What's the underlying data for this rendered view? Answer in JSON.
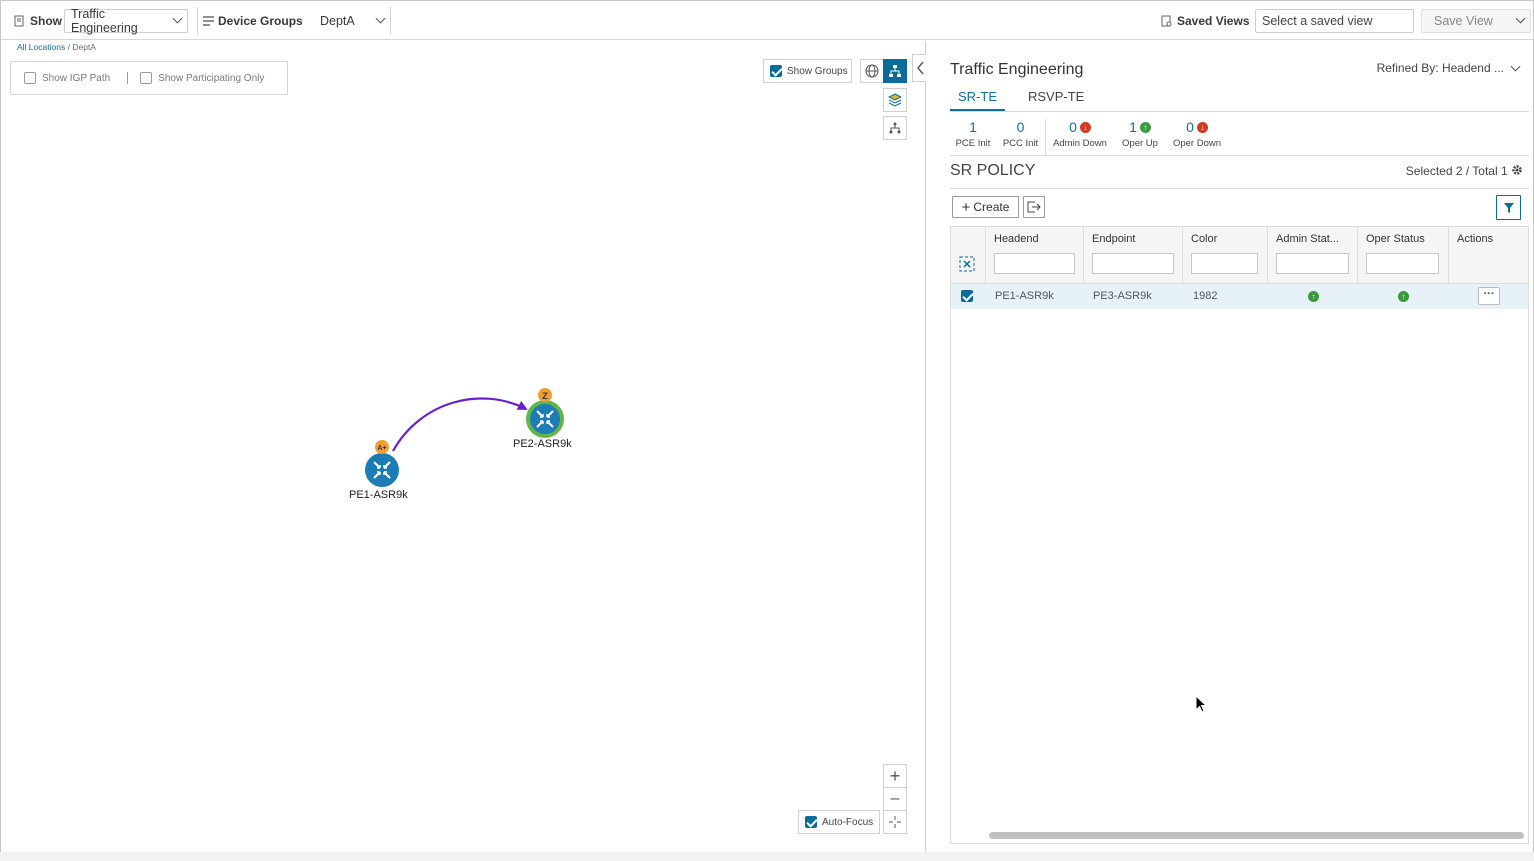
{
  "topbar": {
    "show_label": "Show",
    "show_value": "Traffic Engineering",
    "device_groups_label": "Device Groups",
    "device_group_value": "DeptA",
    "saved_views_label": "Saved Views",
    "saved_view_placeholder": "Select a saved view",
    "save_view_label": "Save View"
  },
  "map": {
    "breadcrumb_root": "All Locations",
    "breadcrumb_sep": "/",
    "breadcrumb_current": "DeptA",
    "show_igp_path": "Show IGP Path",
    "show_participating_only": "Show Participating Only",
    "show_groups": "Show Groups",
    "auto_focus": "Auto-Focus",
    "nodes": [
      {
        "label": "PE1-ASR9k",
        "badge": "A+"
      },
      {
        "label": "PE2-ASR9k",
        "badge": "Z"
      }
    ],
    "link_color": "#6a1fd0"
  },
  "panel": {
    "title": "Traffic Engineering",
    "refined_by": "Refined By: Headend ...",
    "tabs": [
      "SR-TE",
      "RSVP-TE"
    ],
    "stats": [
      {
        "value": "1",
        "label": "PCE Init"
      },
      {
        "value": "0",
        "label": "PCC Init"
      },
      {
        "value": "0",
        "label": "Admin Down",
        "status": "down"
      },
      {
        "value": "1",
        "label": "Oper Up",
        "status": "up"
      },
      {
        "value": "0",
        "label": "Oper Down",
        "status": "down"
      }
    ],
    "section_title": "SR POLICY",
    "selection_info": "Selected 2 / Total 1",
    "create_label": "Create",
    "columns": [
      "Headend",
      "Endpoint",
      "Color",
      "Admin Stat...",
      "Oper Status",
      "Actions"
    ],
    "rows": [
      {
        "headend": "PE1-ASR9k",
        "endpoint": "PE3-ASR9k",
        "color": "1982",
        "admin_status": "up",
        "oper_status": "up"
      }
    ]
  },
  "colors": {
    "accent": "#0d6fa6",
    "node_fill": "#1d7bb5",
    "badge": "#f0a030",
    "status_up": "#3a9a3c",
    "status_down": "#d03b21"
  }
}
